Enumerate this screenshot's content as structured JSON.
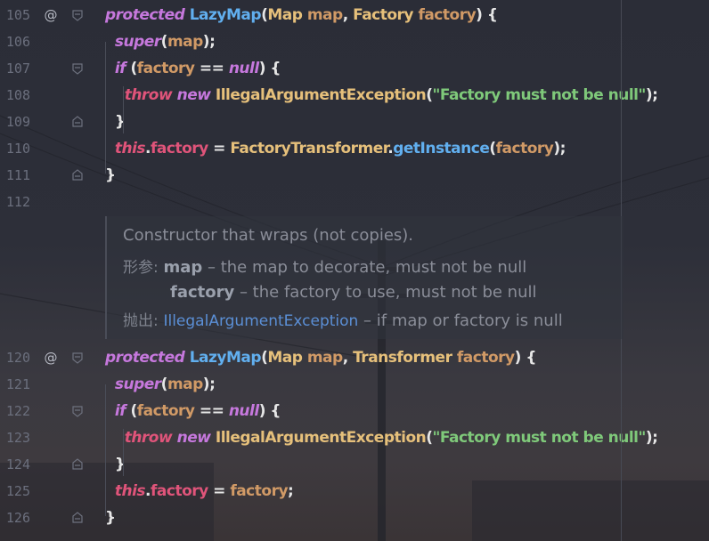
{
  "editor": {
    "lines": [
      {
        "num": "105",
        "ann": "@",
        "tokens": [
          [
            "kw",
            "protected"
          ],
          [
            "pl",
            " "
          ],
          [
            "fn",
            "LazyMap"
          ],
          [
            "pl",
            "("
          ],
          [
            "ty",
            "Map"
          ],
          [
            "pl",
            " "
          ],
          [
            "pa",
            "map"
          ],
          [
            "pl",
            ", "
          ],
          [
            "ty",
            "Factory"
          ],
          [
            "pl",
            " "
          ],
          [
            "pa",
            "factory"
          ],
          [
            "pl",
            ") {"
          ]
        ]
      },
      {
        "num": "106",
        "ann": "",
        "tokens": [
          [
            "pl",
            "  "
          ],
          [
            "kw",
            "super"
          ],
          [
            "pl",
            "("
          ],
          [
            "pa",
            "map"
          ],
          [
            "pl",
            ");"
          ]
        ]
      },
      {
        "num": "107",
        "ann": "",
        "tokens": [
          [
            "pl",
            "  "
          ],
          [
            "kw",
            "if"
          ],
          [
            "pl",
            " ("
          ],
          [
            "pa",
            "factory"
          ],
          [
            "pl",
            " == "
          ],
          [
            "kw",
            "null"
          ],
          [
            "pl",
            ") {"
          ]
        ]
      },
      {
        "num": "108",
        "ann": "",
        "tokens": [
          [
            "pl",
            "    "
          ],
          [
            "kw2",
            "throw"
          ],
          [
            "pl",
            " "
          ],
          [
            "kw",
            "new"
          ],
          [
            "pl",
            " "
          ],
          [
            "ty",
            "IllegalArgumentException"
          ],
          [
            "pl",
            "("
          ],
          [
            "st",
            "\"Factory must not be null\""
          ],
          [
            "pl",
            ");"
          ]
        ]
      },
      {
        "num": "109",
        "ann": "",
        "tokens": [
          [
            "pl",
            "  }"
          ]
        ]
      },
      {
        "num": "110",
        "ann": "",
        "tokens": [
          [
            "pl",
            "  "
          ],
          [
            "kw2",
            "this"
          ],
          [
            "pl",
            "."
          ],
          [
            "fd",
            "factory"
          ],
          [
            "pl",
            " = "
          ],
          [
            "ty",
            "FactoryTransformer"
          ],
          [
            "pl",
            "."
          ],
          [
            "fn",
            "getInstance"
          ],
          [
            "pl",
            "("
          ],
          [
            "pa",
            "factory"
          ],
          [
            "pl",
            ");"
          ]
        ]
      },
      {
        "num": "111",
        "ann": "",
        "tokens": [
          [
            "pl",
            "}"
          ]
        ]
      },
      {
        "num": "112",
        "ann": "",
        "tokens": []
      },
      {
        "num": "120",
        "ann": "@",
        "tokens": [
          [
            "kw",
            "protected"
          ],
          [
            "pl",
            " "
          ],
          [
            "fn",
            "LazyMap"
          ],
          [
            "pl",
            "("
          ],
          [
            "ty",
            "Map"
          ],
          [
            "pl",
            " "
          ],
          [
            "pa",
            "map"
          ],
          [
            "pl",
            ", "
          ],
          [
            "ty",
            "Transformer"
          ],
          [
            "pl",
            " "
          ],
          [
            "pa",
            "factory"
          ],
          [
            "pl",
            ") {"
          ]
        ]
      },
      {
        "num": "121",
        "ann": "",
        "tokens": [
          [
            "pl",
            "  "
          ],
          [
            "kw",
            "super"
          ],
          [
            "pl",
            "("
          ],
          [
            "pa",
            "map"
          ],
          [
            "pl",
            ");"
          ]
        ]
      },
      {
        "num": "122",
        "ann": "",
        "tokens": [
          [
            "pl",
            "  "
          ],
          [
            "kw",
            "if"
          ],
          [
            "pl",
            " ("
          ],
          [
            "pa",
            "factory"
          ],
          [
            "pl",
            " == "
          ],
          [
            "kw",
            "null"
          ],
          [
            "pl",
            ") {"
          ]
        ]
      },
      {
        "num": "123",
        "ann": "",
        "tokens": [
          [
            "pl",
            "    "
          ],
          [
            "kw2",
            "throw"
          ],
          [
            "pl",
            " "
          ],
          [
            "kw",
            "new"
          ],
          [
            "pl",
            " "
          ],
          [
            "ty",
            "IllegalArgumentException"
          ],
          [
            "pl",
            "("
          ],
          [
            "st",
            "\"Factory must not be null\""
          ],
          [
            "pl",
            ");"
          ]
        ]
      },
      {
        "num": "124",
        "ann": "",
        "tokens": [
          [
            "pl",
            "  }"
          ]
        ]
      },
      {
        "num": "125",
        "ann": "",
        "tokens": [
          [
            "pl",
            "  "
          ],
          [
            "kw2",
            "this"
          ],
          [
            "pl",
            "."
          ],
          [
            "fd",
            "factory"
          ],
          [
            "pl",
            " = "
          ],
          [
            "pa",
            "factory"
          ],
          [
            "pl",
            ";"
          ]
        ]
      },
      {
        "num": "126",
        "ann": "",
        "tokens": [
          [
            "pl",
            "}"
          ]
        ]
      }
    ]
  },
  "doc": {
    "summary": "Constructor that wraps (not copies).",
    "params_label": "形参:",
    "param1_name": "map",
    "param1_desc": " – the map to decorate, must not be null",
    "param2_name": "factory",
    "param2_desc": " – the factory to use, must not be null",
    "throws_label": "抛出:",
    "throws_type": "IllegalArgumentException",
    "throws_desc": " – if map or factory is null"
  },
  "colors": {
    "keyword": "#c678dd",
    "function": "#61afef",
    "type": "#e6c07b",
    "param": "#d19a66",
    "string": "#7fc97a",
    "field": "#e0547a"
  }
}
